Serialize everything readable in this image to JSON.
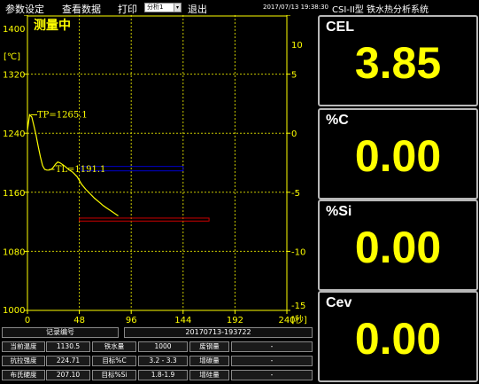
{
  "menu": {
    "items": [
      "参数设定",
      "查看数据",
      "打印",
      "退出"
    ],
    "select_value": "分析1",
    "datetime": "2017/07/13 19:38:30",
    "title": "CSI-II型 铁水热分析系统"
  },
  "chart": {
    "status": "测量中",
    "y_unit": "[℃]",
    "x_unit": "[秒]",
    "y_ticks": [
      "1400",
      "1320",
      "1240",
      "1160",
      "1080",
      "1000"
    ],
    "y_range": [
      1000,
      1400
    ],
    "x_ticks": [
      "0",
      "48",
      "96",
      "144",
      "192",
      "240"
    ],
    "x_range": [
      0,
      240
    ],
    "y2_ticks": [
      "10",
      "5",
      "0",
      "-5",
      "-10",
      "-15"
    ],
    "y2_range": [
      -15,
      10
    ],
    "tp_label": "TP=1265.1",
    "tl_label": "TL=1191.1",
    "colors": {
      "axis": "#ffff00",
      "curve": "#ffff00",
      "grid": "#c8c800",
      "blue_band": "#0000cc",
      "red_band": "#cc0000"
    }
  },
  "chart_data": {
    "type": "line",
    "title": "",
    "xlabel": "[秒]",
    "ylabel": "[℃]",
    "xlim": [
      0,
      240
    ],
    "ylim": [
      1000,
      1400
    ],
    "y2lim": [
      -15,
      10
    ],
    "grid": true,
    "series": [
      {
        "x": [
          0,
          2,
          4,
          6,
          8,
          10,
          12,
          14,
          16,
          18,
          20,
          22,
          24,
          26,
          28,
          30,
          34,
          38,
          42,
          46,
          50,
          54,
          58,
          62,
          66,
          70,
          74,
          78,
          82,
          84
        ],
        "y": [
          1244,
          1265,
          1262,
          1250,
          1237,
          1222,
          1208,
          1196,
          1191,
          1190,
          1190,
          1191,
          1194,
          1198,
          1201,
          1200,
          1196,
          1191,
          1187,
          1181,
          1171,
          1164,
          1158,
          1152,
          1147,
          1142,
          1138,
          1134,
          1130,
          1128
        ]
      }
    ],
    "annotations": [
      "TP=1265.1",
      "TL=1191.1"
    ]
  },
  "record": {
    "label": "记录编号",
    "value": "20170713-193722"
  },
  "table": [
    [
      "当前温度",
      "1130.5",
      "铁水量",
      "1000",
      "废钢量",
      "-"
    ],
    [
      "抗拉强度",
      "224.71",
      "目标%C",
      "3.2 - 3.3",
      "增碳量",
      "-"
    ],
    [
      "布氏硬度",
      "207.10",
      "目标%Si",
      "1.8-1.9",
      "增硅量",
      "-"
    ]
  ],
  "panels": [
    {
      "label": "CEL",
      "value": "3.85"
    },
    {
      "label": "%C",
      "value": "0.00"
    },
    {
      "label": "%Si",
      "value": "0.00"
    },
    {
      "label": "Cev",
      "value": "0.00"
    }
  ]
}
